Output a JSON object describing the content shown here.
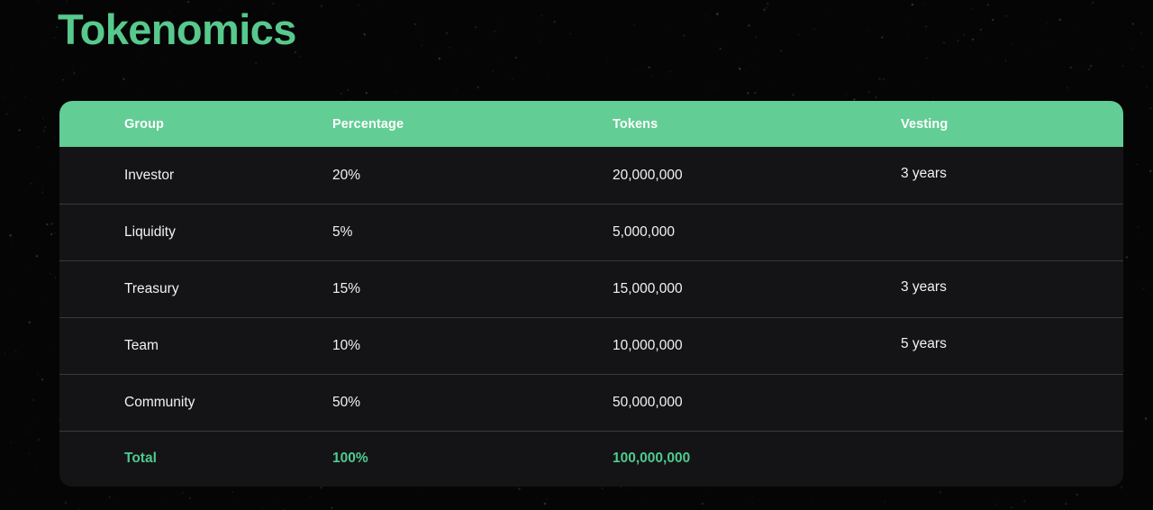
{
  "page": {
    "title": "Tokenomics",
    "accent_color": "#57c98c",
    "header_bg": "#62cd95",
    "row_bg": "#141416",
    "page_bg": "#050506",
    "total_text_color": "#4fc98d"
  },
  "table": {
    "columns": [
      {
        "key": "group",
        "label": "Group"
      },
      {
        "key": "percentage",
        "label": "Percentage"
      },
      {
        "key": "tokens",
        "label": "Tokens"
      },
      {
        "key": "vesting",
        "label": "Vesting"
      }
    ],
    "rows": [
      {
        "group": "Investor",
        "percentage": "20%",
        "tokens": "20,000,000",
        "vesting": "3 years"
      },
      {
        "group": "Liquidity",
        "percentage": "5%",
        "tokens": "5,000,000",
        "vesting": ""
      },
      {
        "group": "Treasury",
        "percentage": "15%",
        "tokens": "15,000,000",
        "vesting": "3 years"
      },
      {
        "group": "Team",
        "percentage": "10%",
        "tokens": "10,000,000",
        "vesting": "5 years"
      },
      {
        "group": "Community",
        "percentage": "50%",
        "tokens": "50,000,000",
        "vesting": ""
      }
    ],
    "total": {
      "group": "Total",
      "percentage": "100%",
      "tokens": "100,000,000",
      "vesting": ""
    }
  },
  "chart_data": {
    "type": "table",
    "title": "Tokenomics",
    "categories": [
      "Investor",
      "Liquidity",
      "Treasury",
      "Team",
      "Community"
    ],
    "values": [
      20,
      5,
      15,
      10,
      50
    ],
    "token_amounts": [
      20000000,
      5000000,
      15000000,
      10000000,
      50000000
    ],
    "vesting": [
      "3 years",
      "",
      "3 years",
      "5 years",
      ""
    ],
    "total_percentage": 100,
    "total_tokens": 100000000,
    "ylabel": "Percentage"
  }
}
